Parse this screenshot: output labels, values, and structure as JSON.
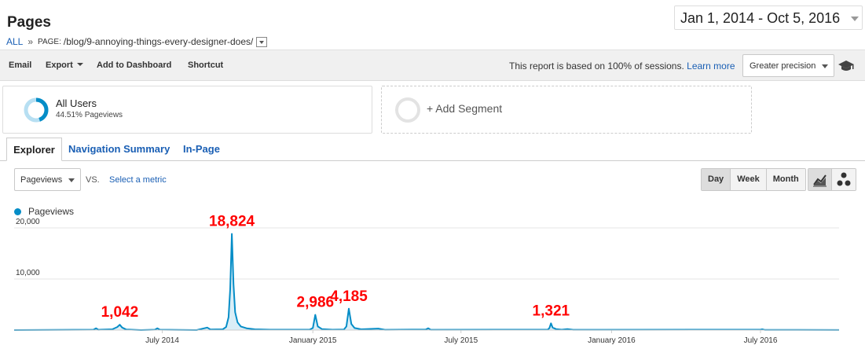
{
  "header": {
    "title": "Pages",
    "breadcrumb_all": "ALL",
    "breadcrumb_sep": "»",
    "breadcrumb_key": "PAGE:",
    "breadcrumb_value": "/blog/9-annoying-things-every-designer-does/",
    "date_range": "Jan 1, 2014 - Oct 5, 2016"
  },
  "toolbar": {
    "email": "Email",
    "export": "Export",
    "add_to_dashboard": "Add to Dashboard",
    "shortcut": "Shortcut",
    "sampling_note": "This report is based on 100% of sessions.",
    "learn_more": "Learn more",
    "precision": "Greater precision"
  },
  "segments": {
    "all_users_name": "All Users",
    "all_users_sub": "44.51% Pageviews",
    "all_users_fraction": 0.4451,
    "add_segment": "+ Add Segment"
  },
  "tabs": {
    "explorer": "Explorer",
    "navigation_summary": "Navigation Summary",
    "in_page": "In-Page"
  },
  "metric": {
    "selected": "Pageviews",
    "vs": "VS.",
    "select_metric": "Select a metric"
  },
  "granularity": {
    "day": "Day",
    "week": "Week",
    "month": "Month",
    "active": "day"
  },
  "colors": {
    "series": "#058dc7",
    "annotation": "#ff0000",
    "link": "#1a5fb4"
  },
  "chart_data": {
    "type": "line",
    "series": [
      {
        "name": "Pageviews",
        "points": [
          [
            "2014-01-01",
            0
          ],
          [
            "2014-04-08",
            80
          ],
          [
            "2014-04-11",
            350
          ],
          [
            "2014-04-14",
            60
          ],
          [
            "2014-05-01",
            150
          ],
          [
            "2014-05-07",
            600
          ],
          [
            "2014-05-10",
            1042
          ],
          [
            "2014-05-13",
            500
          ],
          [
            "2014-05-18",
            100
          ],
          [
            "2014-06-05",
            0
          ],
          [
            "2014-06-22",
            80
          ],
          [
            "2014-06-25",
            350
          ],
          [
            "2014-06-28",
            80
          ],
          [
            "2014-08-12",
            0
          ],
          [
            "2014-08-25",
            500
          ],
          [
            "2014-08-29",
            100
          ],
          [
            "2014-09-13",
            150
          ],
          [
            "2014-09-17",
            600
          ],
          [
            "2014-09-20",
            2500
          ],
          [
            "2014-09-22",
            8000
          ],
          [
            "2014-09-24",
            18824
          ],
          [
            "2014-09-26",
            9000
          ],
          [
            "2014-09-28",
            3500
          ],
          [
            "2014-10-01",
            1500
          ],
          [
            "2014-10-05",
            700
          ],
          [
            "2014-10-12",
            350
          ],
          [
            "2014-10-22",
            150
          ],
          [
            "2014-11-10",
            80
          ],
          [
            "2014-12-28",
            80
          ],
          [
            "2015-01-01",
            400
          ],
          [
            "2015-01-04",
            2986
          ],
          [
            "2015-01-07",
            700
          ],
          [
            "2015-01-12",
            200
          ],
          [
            "2015-01-25",
            80
          ],
          [
            "2015-02-08",
            100
          ],
          [
            "2015-02-11",
            700
          ],
          [
            "2015-02-14",
            4185
          ],
          [
            "2015-02-17",
            1200
          ],
          [
            "2015-02-21",
            400
          ],
          [
            "2015-03-01",
            150
          ],
          [
            "2015-03-22",
            300
          ],
          [
            "2015-03-30",
            60
          ],
          [
            "2015-05-19",
            100
          ],
          [
            "2015-05-22",
            350
          ],
          [
            "2015-05-25",
            60
          ],
          [
            "2015-10-15",
            80
          ],
          [
            "2015-10-17",
            400
          ],
          [
            "2015-10-19",
            1321
          ],
          [
            "2015-10-21",
            500
          ],
          [
            "2015-10-25",
            200
          ],
          [
            "2015-11-01",
            80
          ],
          [
            "2015-11-08",
            200
          ],
          [
            "2015-11-15",
            60
          ],
          [
            "2016-07-01",
            80
          ],
          [
            "2016-07-03",
            150
          ],
          [
            "2016-07-06",
            40
          ],
          [
            "2016-10-05",
            20
          ]
        ]
      }
    ],
    "x_ticks": [
      {
        "date": "2014-07-01",
        "label": "July 2014"
      },
      {
        "date": "2015-01-01",
        "label": "January 2015"
      },
      {
        "date": "2015-07-01",
        "label": "July 2015"
      },
      {
        "date": "2016-01-01",
        "label": "January 2016"
      },
      {
        "date": "2016-07-01",
        "label": "July 2016"
      }
    ],
    "y_ticks": [
      {
        "value": 10000,
        "label": "10,000"
      },
      {
        "value": 20000,
        "label": "20,000"
      }
    ],
    "xlim": [
      "2014-01-01",
      "2016-10-05"
    ],
    "ylim": [
      0,
      20000
    ],
    "grid": true,
    "legend": "top-left",
    "annotations": [
      {
        "date": "2014-05-10",
        "value": 1042,
        "label": "1,042"
      },
      {
        "date": "2014-09-24",
        "value": 18824,
        "label": "18,824"
      },
      {
        "date": "2015-01-04",
        "value": 2986,
        "label": "2,986"
      },
      {
        "date": "2015-02-14",
        "value": 4185,
        "label": "4,185"
      },
      {
        "date": "2015-10-19",
        "value": 1321,
        "label": "1,321"
      }
    ]
  }
}
